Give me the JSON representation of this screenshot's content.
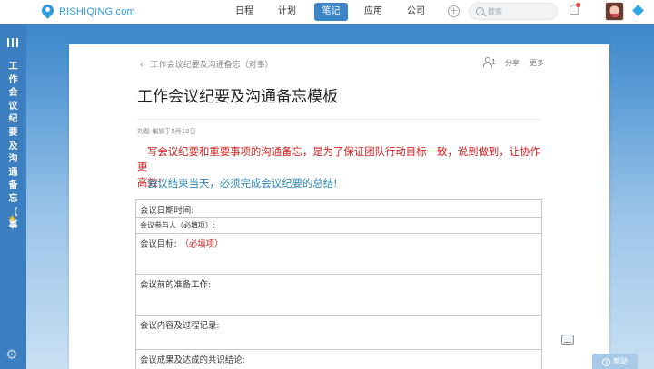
{
  "topbar": {
    "logo_text": "RISHIQING.com",
    "nav": [
      "日程",
      "计划",
      "笔记",
      "应用",
      "公司"
    ],
    "active_nav": "笔记",
    "search_placeholder": "搜索"
  },
  "rail": {
    "vertical_title": [
      "工",
      "作",
      "会",
      "议",
      "纪",
      "要",
      "及",
      "沟",
      "通",
      "备",
      "忘",
      "（",
      "事"
    ]
  },
  "note": {
    "breadcrumb": "工作会议纪要及沟通备忘（对事）",
    "member_count": "1",
    "share_label": "分享",
    "more_label": "更多",
    "title": "工作会议纪要及沟通备忘模板",
    "meta": "刘磊 编辑于8月10日",
    "red_line_1": "写会议纪要和重要事项的沟通备忘，是为了保证团队行动目标一致，说到做到，让协作更",
    "red_line_2": "高效!",
    "blue_line": "会议结束当天，必须完成会议纪要的总结!",
    "table_rows": [
      {
        "label": "会议日期时间:",
        "required": ""
      },
      {
        "label": "会议参与人（必填项）:",
        "required": ""
      },
      {
        "label": "会议目标:",
        "required": "（必填项）"
      },
      {
        "label": "会议前的准备工作:",
        "required": ""
      },
      {
        "label": "会议内容及过程记录:",
        "required": ""
      },
      {
        "label": "会议成果及达成的共识结论:",
        "required": ""
      }
    ]
  },
  "help_label": "帮助",
  "colors": {
    "accent": "#3a86c8",
    "rail": "#3c7fc0",
    "red_text": "#d21f1f",
    "blue_text": "#2a85b5"
  }
}
